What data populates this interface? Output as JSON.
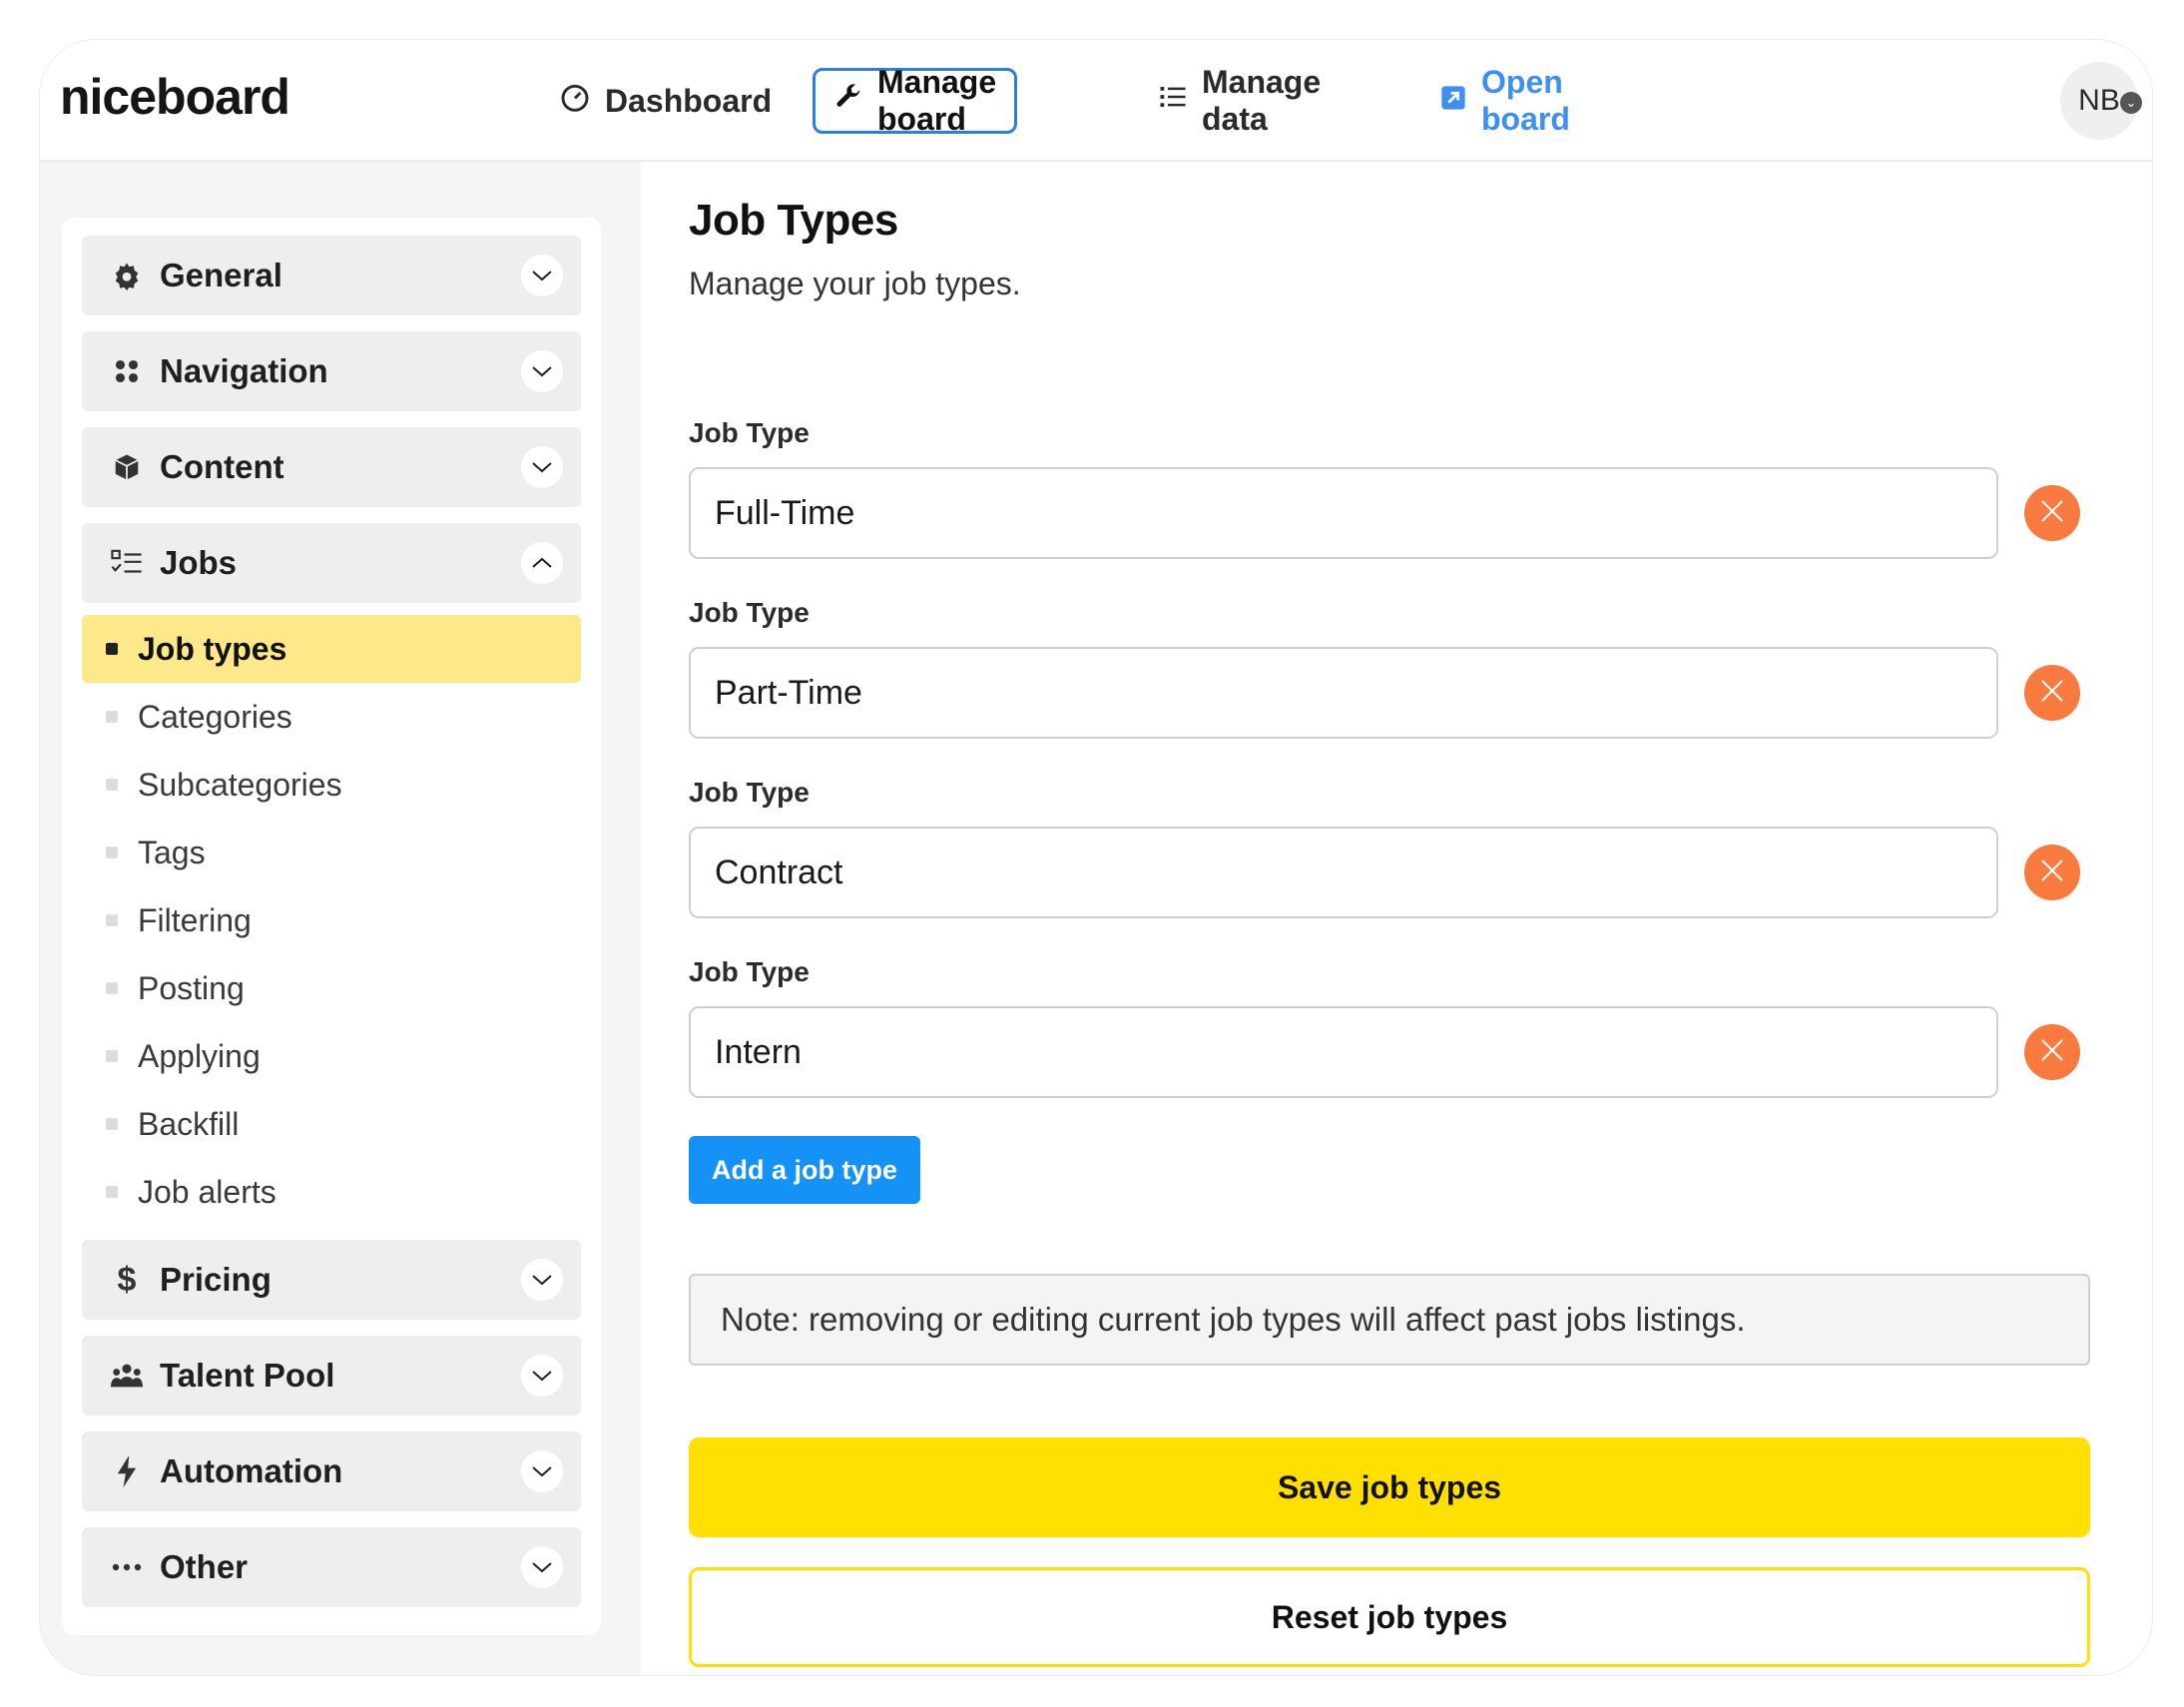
{
  "header": {
    "logo": "niceboard",
    "nav": [
      {
        "label": "Dashboard",
        "icon": "gauge-icon"
      },
      {
        "label": "Manage board",
        "icon": "wrench-icon"
      },
      {
        "label": "Manage data",
        "icon": "list-icon"
      },
      {
        "label": "Open board",
        "icon": "external-link-icon"
      }
    ],
    "avatar": "NB"
  },
  "sidebar": {
    "groups_top": [
      {
        "label": "General",
        "icon": "gear-icon"
      },
      {
        "label": "Navigation",
        "icon": "grid-dots-icon"
      },
      {
        "label": "Content",
        "icon": "cube-icon"
      },
      {
        "label": "Jobs",
        "icon": "checklist-icon",
        "expanded": true
      }
    ],
    "jobs_items": [
      "Job types",
      "Categories",
      "Subcategories",
      "Tags",
      "Filtering",
      "Posting",
      "Applying",
      "Backfill",
      "Job alerts"
    ],
    "active_item": "Job types",
    "groups_bottom": [
      {
        "label": "Pricing",
        "icon": "dollar-icon"
      },
      {
        "label": "Talent Pool",
        "icon": "people-icon"
      },
      {
        "label": "Automation",
        "icon": "bolt-icon"
      },
      {
        "label": "Other",
        "icon": "ellipsis-icon"
      }
    ]
  },
  "main": {
    "title": "Job Types",
    "subtitle": "Manage your job types.",
    "field_label": "Job Type",
    "job_types": [
      "Full-Time",
      "Part-Time",
      "Contract",
      "Intern"
    ],
    "add_button": "Add a job type",
    "note": "Note: removing or editing current job types will affect past jobs listings.",
    "save_button": "Save job types",
    "reset_button": "Reset job types"
  },
  "colors": {
    "accent_blue": "#1592f5",
    "active_nav_border": "#2a7de1",
    "open_board_link": "#3d8ff0",
    "delete_orange": "#f97a3e",
    "save_yellow": "#ffe000",
    "active_item_bg": "#fde98a"
  }
}
